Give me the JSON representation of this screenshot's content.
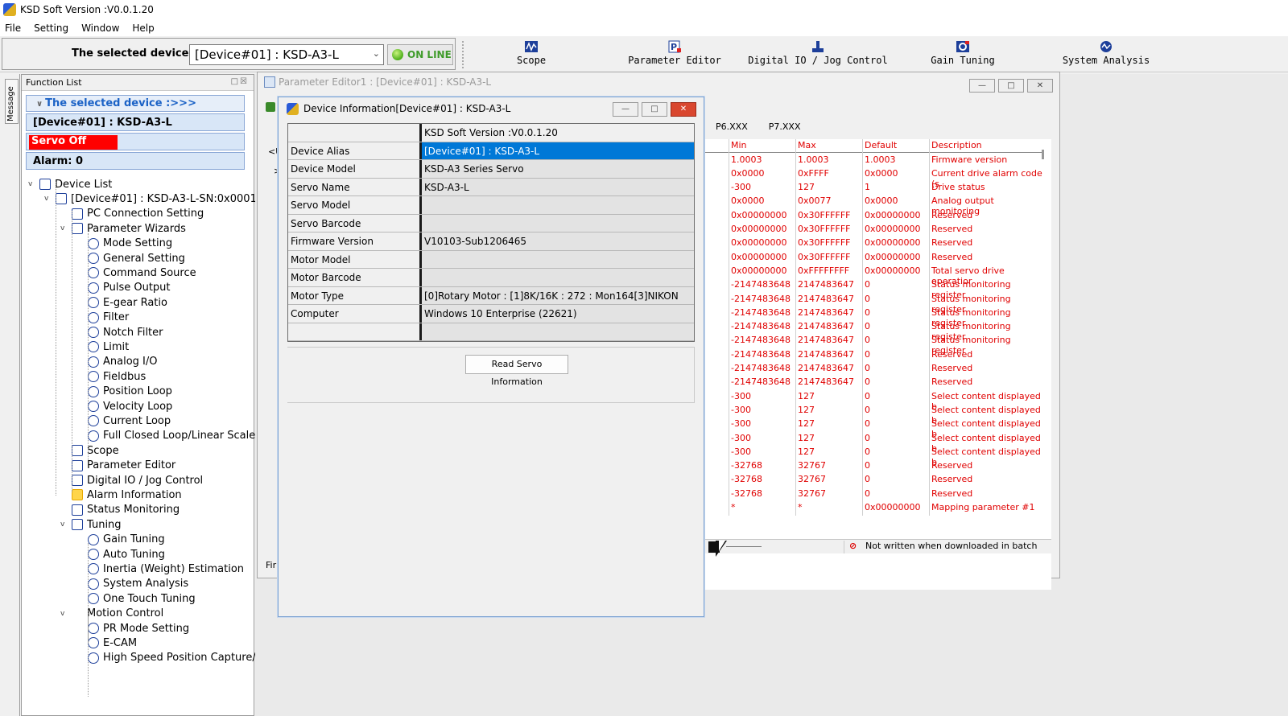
{
  "window": {
    "title": "KSD Soft Version :V0.0.1.20"
  },
  "menu": [
    "File",
    "Setting",
    "Window",
    "Help"
  ],
  "toolbar": {
    "selected_device_label": "The selected device :",
    "selected_device_value": "[Device#01]  : KSD-A3-L",
    "online_label": "ON LINE",
    "buttons": [
      {
        "label": "Scope",
        "icon": "scope-icon"
      },
      {
        "label": "Parameter Editor",
        "icon": "parameter-editor-icon"
      },
      {
        "label": "Digital IO / Jog Control",
        "icon": "digital-io-icon"
      },
      {
        "label": "Gain Tuning",
        "icon": "gain-tuning-icon"
      },
      {
        "label": "System Analysis",
        "icon": "system-analysis-icon"
      }
    ]
  },
  "message_tab": "Message",
  "function_list": {
    "header": "Function List",
    "selected_title": "The selected device :>>>",
    "selected_device": "[Device#01]  : KSD-A3-L",
    "servo_status": "Servo Off",
    "alarm": "Alarm: 0",
    "tree": [
      {
        "label": "Device List",
        "level": 0,
        "icon": "device-list-icon",
        "expander": "v"
      },
      {
        "label": "[Device#01]  : KSD-A3-L-SN:0x0001",
        "level": 1,
        "icon": "device-node-icon",
        "expander": "v"
      },
      {
        "label": "PC Connection Setting",
        "level": 2,
        "icon": "pc-connection-icon",
        "expander": ""
      },
      {
        "label": "Parameter Wizards",
        "level": 2,
        "icon": "wizard-icon",
        "expander": "v"
      },
      {
        "label": "Mode Setting",
        "level": 3,
        "icon": "mode-setting-icon",
        "expander": ""
      },
      {
        "label": "General Setting",
        "level": 3,
        "icon": "gear-icon",
        "expander": ""
      },
      {
        "label": "Command Source",
        "level": 3,
        "icon": "command-source-icon",
        "expander": ""
      },
      {
        "label": "Pulse Output",
        "level": 3,
        "icon": "pulse-output-icon",
        "expander": ""
      },
      {
        "label": "E-gear Ratio",
        "level": 3,
        "icon": "egear-icon",
        "expander": ""
      },
      {
        "label": "Filter",
        "level": 3,
        "icon": "filter-icon",
        "expander": ""
      },
      {
        "label": "Notch Filter",
        "level": 3,
        "icon": "notch-filter-icon",
        "expander": ""
      },
      {
        "label": "Limit",
        "level": 3,
        "icon": "limit-icon",
        "expander": ""
      },
      {
        "label": "Analog I/O",
        "level": 3,
        "icon": "analog-io-icon",
        "expander": ""
      },
      {
        "label": "Fieldbus",
        "level": 3,
        "icon": "fieldbus-icon",
        "expander": ""
      },
      {
        "label": "Position Loop",
        "level": 3,
        "icon": "position-loop-icon",
        "expander": ""
      },
      {
        "label": "Velocity Loop",
        "level": 3,
        "icon": "velocity-loop-icon",
        "expander": ""
      },
      {
        "label": "Current Loop",
        "level": 3,
        "icon": "current-loop-icon",
        "expander": ""
      },
      {
        "label": "Full Closed Loop/Linear Scale",
        "level": 3,
        "icon": "full-closed-loop-icon",
        "expander": ""
      },
      {
        "label": "Scope",
        "level": 2,
        "icon": "scope-icon",
        "expander": ""
      },
      {
        "label": "Parameter Editor",
        "level": 2,
        "icon": "parameter-editor-icon",
        "expander": ""
      },
      {
        "label": "Digital IO / Jog Control",
        "level": 2,
        "icon": "digital-io-icon",
        "expander": ""
      },
      {
        "label": "Alarm Information",
        "level": 2,
        "icon": "alarm-icon",
        "expander": ""
      },
      {
        "label": "Status Monitoring",
        "level": 2,
        "icon": "status-monitoring-icon",
        "expander": ""
      },
      {
        "label": "Tuning",
        "level": 2,
        "icon": "tuning-icon",
        "expander": "v"
      },
      {
        "label": "Gain Tuning",
        "level": 3,
        "icon": "gain-tuning-icon",
        "expander": ""
      },
      {
        "label": "Auto Tuning",
        "level": 3,
        "icon": "auto-tuning-icon",
        "expander": ""
      },
      {
        "label": "Inertia (Weight) Estimation",
        "level": 3,
        "icon": "inertia-icon",
        "expander": ""
      },
      {
        "label": "System Analysis",
        "level": 3,
        "icon": "system-analysis-icon",
        "expander": ""
      },
      {
        "label": "One Touch Tuning",
        "level": 3,
        "icon": "one-touch-tuning-icon",
        "expander": ""
      },
      {
        "label": "Motion Control",
        "level": 2,
        "icon": "",
        "expander": "v"
      },
      {
        "label": "PR Mode Setting",
        "level": 3,
        "icon": "pr-mode-icon",
        "expander": ""
      },
      {
        "label": "E-CAM",
        "level": 3,
        "icon": "ecam-icon",
        "expander": ""
      },
      {
        "label": "High Speed Position Capture/C",
        "level": 3,
        "icon": "position-capture-icon",
        "expander": ""
      }
    ]
  },
  "parameter_editor": {
    "title": "Parameter Editor1 : [Device#01]  : KSD-A3-L",
    "tabs": [
      "P6.XXX",
      "P7.XXX"
    ],
    "left_fragments": [
      "<U",
      ">",
      "Firi"
    ],
    "columns": [
      "Min",
      "Max",
      "Default",
      "Description"
    ],
    "rows": [
      [
        "1.0003",
        "1.0003",
        "1.0003",
        "Firmware version"
      ],
      [
        "0x0000",
        "0xFFFF",
        "0x0000",
        "Current drive alarm code (s"
      ],
      [
        "-300",
        "127",
        "1",
        "Drive status"
      ],
      [
        "0x0000",
        "0x0077",
        "0x0000",
        "Analog output monitoring"
      ],
      [
        "0x00000000",
        "0x30FFFFFF",
        "0x00000000",
        "Reserved"
      ],
      [
        "0x00000000",
        "0x30FFFFFF",
        "0x00000000",
        "Reserved"
      ],
      [
        "0x00000000",
        "0x30FFFFFF",
        "0x00000000",
        "Reserved"
      ],
      [
        "0x00000000",
        "0x30FFFFFF",
        "0x00000000",
        "Reserved"
      ],
      [
        "0x00000000",
        "0xFFFFFFFF",
        "0x00000000",
        "Total servo drive operatior"
      ],
      [
        "-2147483648",
        "2147483647",
        "0",
        "Status monitoring register"
      ],
      [
        "-2147483648",
        "2147483647",
        "0",
        "Status monitoring register"
      ],
      [
        "-2147483648",
        "2147483647",
        "0",
        "Status monitoring register"
      ],
      [
        "-2147483648",
        "2147483647",
        "0",
        "Status monitoring register"
      ],
      [
        "-2147483648",
        "2147483647",
        "0",
        "Status monitoring register"
      ],
      [
        "-2147483648",
        "2147483647",
        "0",
        "Reserved"
      ],
      [
        "-2147483648",
        "2147483647",
        "0",
        "Reserved"
      ],
      [
        "-2147483648",
        "2147483647",
        "0",
        "Reserved"
      ],
      [
        "-300",
        "127",
        "0",
        "Select content displayed b"
      ],
      [
        "-300",
        "127",
        "0",
        "Select content displayed b"
      ],
      [
        "-300",
        "127",
        "0",
        "Select content displayed b"
      ],
      [
        "-300",
        "127",
        "0",
        "Select content displayed b"
      ],
      [
        "-300",
        "127",
        "0",
        "Select content displayed b"
      ],
      [
        "-32768",
        "32767",
        "0",
        "Reserved"
      ],
      [
        "-32768",
        "32767",
        "0",
        "Reserved"
      ],
      [
        "-32768",
        "32767",
        "0",
        "Reserved"
      ],
      [
        "*",
        "*",
        "0x00000000",
        "Mapping parameter #1"
      ]
    ],
    "status_note": "Not written when downloaded in batch"
  },
  "device_info": {
    "title": "Device Information[Device#01]  : KSD-A3-L",
    "header_value": "KSD Soft Version :V0.0.1.20",
    "rows": [
      {
        "key": "Device Alias",
        "value": "[Device#01]  : KSD-A3-L"
      },
      {
        "key": "Device Model",
        "value": "KSD-A3 Series Servo"
      },
      {
        "key": "Servo Name",
        "value": "KSD-A3-L"
      },
      {
        "key": "Servo Model",
        "value": ""
      },
      {
        "key": "Servo Barcode",
        "value": ""
      },
      {
        "key": "Firmware Version",
        "value": "V10103-Sub1206465"
      },
      {
        "key": "Motor Model",
        "value": ""
      },
      {
        "key": "Motor Barcode",
        "value": ""
      },
      {
        "key": "Motor Type",
        "value": "[0]Rotary Motor : [1]8K/16K : 272 : Mon164[3]NIKON"
      },
      {
        "key": "Computer",
        "value": "Windows 10 Enterprise  (22621)"
      },
      {
        "key": "",
        "value": ""
      }
    ],
    "read_button": "Read Servo Information"
  },
  "colors": {
    "selection": "#0078d7",
    "servo_off": "#ff0000",
    "online": "#3f9b2a",
    "param_text": "#e00000"
  }
}
